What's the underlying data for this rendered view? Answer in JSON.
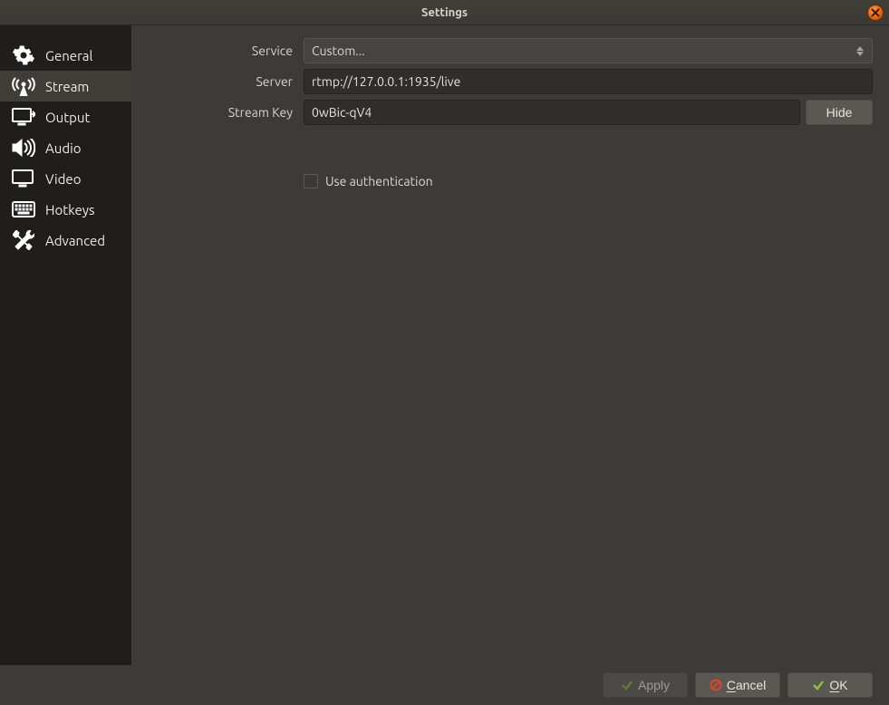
{
  "window": {
    "title": "Settings"
  },
  "sidebar": {
    "items": [
      {
        "label": "General"
      },
      {
        "label": "Stream"
      },
      {
        "label": "Output"
      },
      {
        "label": "Audio"
      },
      {
        "label": "Video"
      },
      {
        "label": "Hotkeys"
      },
      {
        "label": "Advanced"
      }
    ]
  },
  "form": {
    "service_label": "Service",
    "service_value": "Custom...",
    "server_label": "Server",
    "server_value": "rtmp://127.0.0.1:1935/live",
    "streamkey_label": "Stream Key",
    "streamkey_value": "0wBic-qV4",
    "hide_button": "Hide",
    "use_auth_label": "Use authentication"
  },
  "footer": {
    "apply": "Apply",
    "cancel_prefix": "C",
    "cancel_rest": "ancel",
    "ok_prefix": "O",
    "ok_rest": "K"
  }
}
